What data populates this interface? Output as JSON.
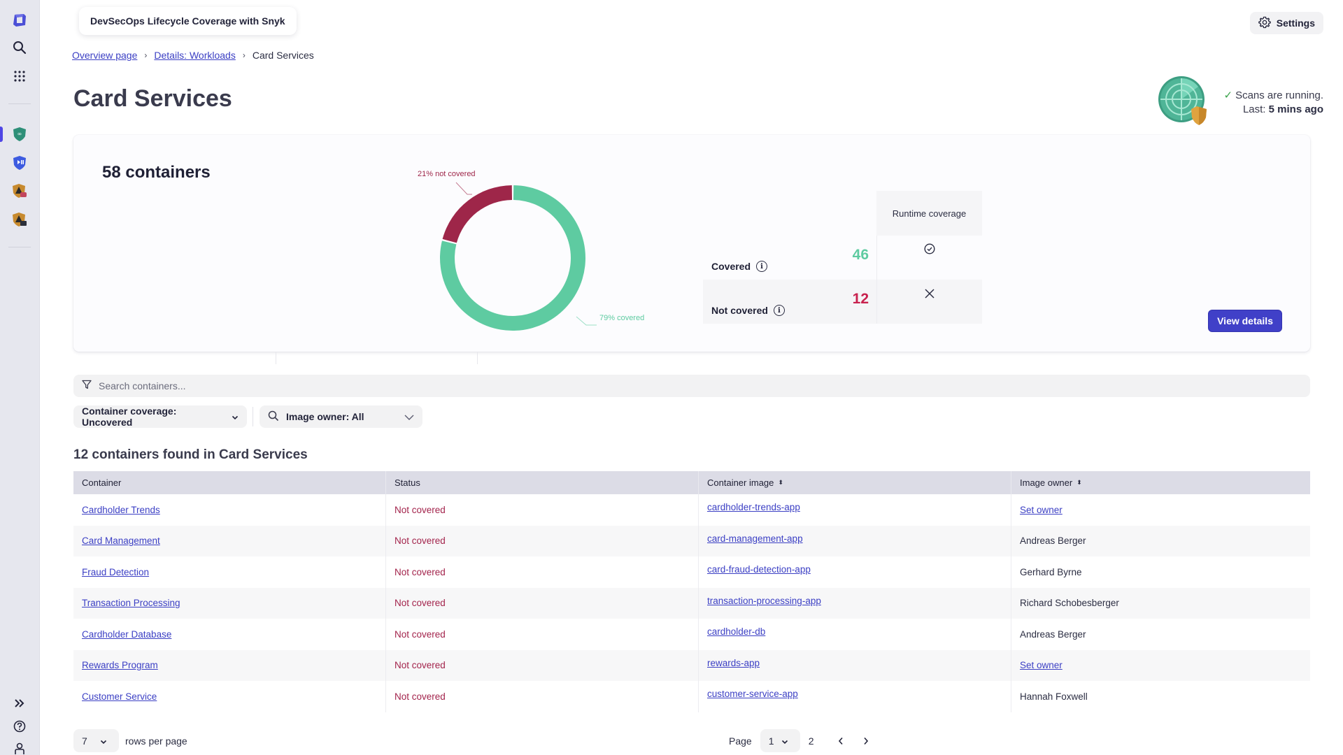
{
  "app": {
    "title": "DevSecOps Lifecycle Coverage with Snyk",
    "settings_label": "Settings"
  },
  "sidebar": {
    "top_items": [
      {
        "icon": "dynatrace-logo-icon"
      },
      {
        "icon": "search-icon"
      },
      {
        "icon": "apps-grid-icon"
      }
    ],
    "app_items": [
      {
        "icon": "devsecops-shield-icon",
        "active": true
      },
      {
        "icon": "play-shield-icon"
      },
      {
        "icon": "alert-shield-icon"
      },
      {
        "icon": "alert-terminal-shield-icon"
      }
    ],
    "bottom_items": [
      {
        "icon": "expand-icon"
      },
      {
        "icon": "help-icon"
      },
      {
        "icon": "user-icon"
      }
    ]
  },
  "breadcrumb": {
    "items": [
      "Overview page",
      "Details: Workloads"
    ],
    "current": "Card Services",
    "separator": "›"
  },
  "page": {
    "title": "Card Services"
  },
  "scan": {
    "status": "Scans are running.",
    "last_label": "Last:",
    "last_value": "5 mins ago"
  },
  "summary": {
    "title": "58 containers",
    "covered_label": "Covered",
    "covered_count": "46",
    "not_covered_label": "Not covered",
    "not_covered_count": "12",
    "column_header": "Runtime coverage",
    "view_details_label": "View details",
    "colors": {
      "covered": "#5ecba1",
      "not_covered": "#9e2649"
    }
  },
  "chart_data": {
    "type": "pie",
    "donut": true,
    "title": "",
    "categories": [
      "not covered",
      "covered"
    ],
    "values": [
      21,
      79
    ],
    "counts": [
      12,
      46
    ],
    "labels": [
      "21% not covered",
      "79% covered"
    ],
    "colors": [
      "#9e2649",
      "#5ecba1"
    ],
    "legend": "none"
  },
  "search": {
    "placeholder": "Search containers...",
    "value": ""
  },
  "filters": {
    "coverage_label": "Container coverage: Uncovered",
    "owner_label": "Image owner: All"
  },
  "results": {
    "title": "12 containers found in Card Services"
  },
  "table": {
    "columns": [
      {
        "label": "Container",
        "sortable": false
      },
      {
        "label": "Status",
        "sortable": false
      },
      {
        "label": "Container image",
        "sortable": true
      },
      {
        "label": "Image owner",
        "sortable": true
      }
    ],
    "rows": [
      {
        "container": "Cardholder Trends",
        "status": "Not covered",
        "image": "cardholder-trends-app",
        "owner": "Set owner",
        "owner_is_link": true
      },
      {
        "container": "Card Management",
        "status": "Not covered",
        "image": "card-management-app",
        "owner": "Andreas Berger",
        "owner_is_link": false
      },
      {
        "container": "Fraud Detection",
        "status": "Not covered",
        "image": "card-fraud-detection-app",
        "owner": "Gerhard Byrne",
        "owner_is_link": false
      },
      {
        "container": "Transaction Processing",
        "status": "Not covered",
        "image": "transaction-processing-app",
        "owner": "Richard Schobesberger",
        "owner_is_link": false
      },
      {
        "container": "Cardholder Database",
        "status": "Not covered",
        "image": "cardholder-db",
        "owner": "Andreas Berger",
        "owner_is_link": false
      },
      {
        "container": "Rewards Program",
        "status": "Not covered",
        "image": "rewards-app",
        "owner": "Set owner",
        "owner_is_link": true
      },
      {
        "container": "Customer Service",
        "status": "Not covered",
        "image": "customer-service-app",
        "owner": "Hannah Foxwell",
        "owner_is_link": false
      }
    ]
  },
  "pagination": {
    "rows_per_page": "7",
    "rows_per_page_label": "rows per page",
    "page_label": "Page",
    "current_page": "1",
    "next_page_number": "2"
  }
}
